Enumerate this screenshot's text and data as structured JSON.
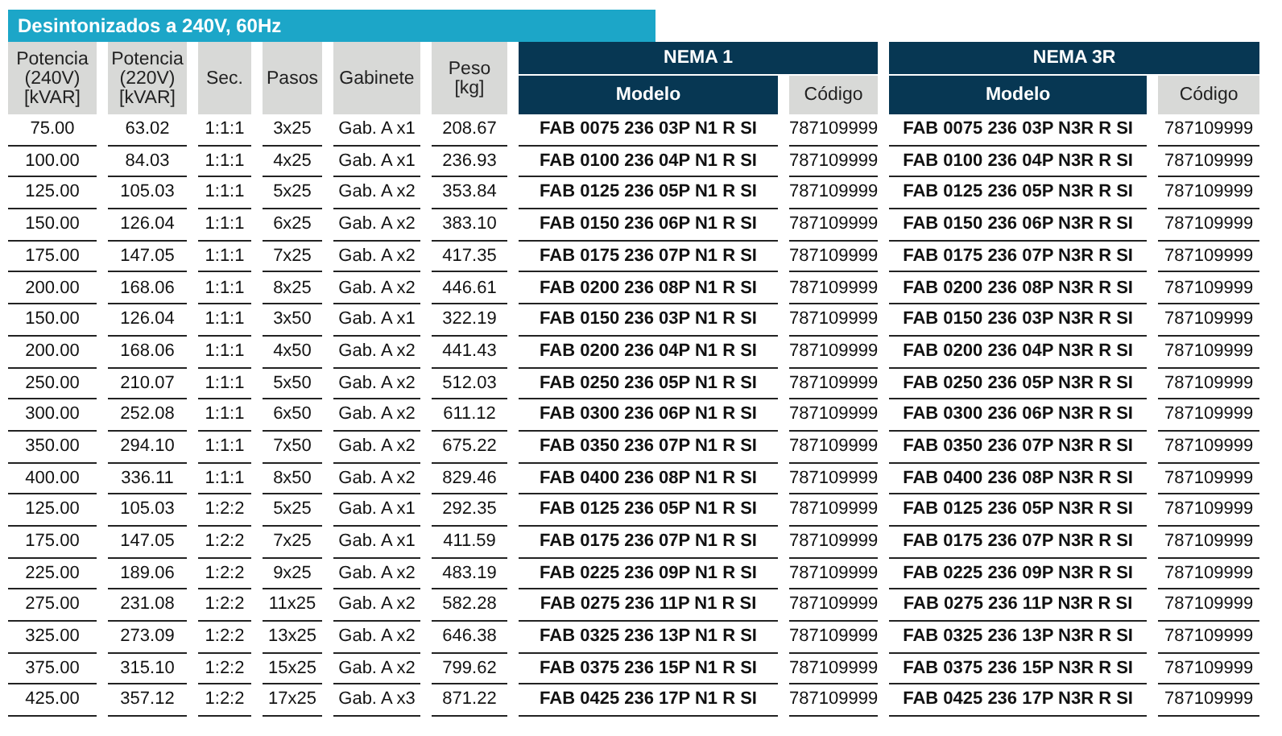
{
  "title": "Desintonizados a 240V, 60Hz",
  "table": {
    "columns": [
      {
        "lines": [
          "Potencia",
          "(240V)",
          "[kVAR]"
        ]
      },
      {
        "lines": [
          "Potencia",
          "(220V)",
          "[kVAR]"
        ]
      },
      {
        "lines": [
          "Sec."
        ]
      },
      {
        "lines": [
          "Pasos"
        ]
      },
      {
        "lines": [
          "Gabinete"
        ]
      },
      {
        "lines": [
          "Peso",
          "[kg]"
        ]
      }
    ],
    "groups": [
      {
        "label": "NEMA 1",
        "columns": [
          "Modelo",
          "Código"
        ]
      },
      {
        "label": "NEMA 3R",
        "columns": [
          "Modelo",
          "Código"
        ]
      }
    ],
    "rows": [
      [
        "75.00",
        "63.02",
        "1:1:1",
        "3x25",
        "Gab. A x1",
        "208.67",
        "FAB 0075 236 03P N1 R SI",
        "787109999",
        "FAB 0075 236 03P N3R R SI",
        "787109999"
      ],
      [
        "100.00",
        "84.03",
        "1:1:1",
        "4x25",
        "Gab. A x1",
        "236.93",
        "FAB 0100 236 04P N1 R SI",
        "787109999",
        "FAB 0100 236 04P N3R R SI",
        "787109999"
      ],
      [
        "125.00",
        "105.03",
        "1:1:1",
        "5x25",
        "Gab. A x2",
        "353.84",
        "FAB 0125 236 05P N1 R SI",
        "787109999",
        "FAB 0125 236 05P N3R R SI",
        "787109999"
      ],
      [
        "150.00",
        "126.04",
        "1:1:1",
        "6x25",
        "Gab. A x2",
        "383.10",
        "FAB 0150 236 06P N1 R SI",
        "787109999",
        "FAB 0150 236 06P N3R R SI",
        "787109999"
      ],
      [
        "175.00",
        "147.05",
        "1:1:1",
        "7x25",
        "Gab. A x2",
        "417.35",
        "FAB 0175 236 07P N1 R SI",
        "787109999",
        "FAB 0175 236 07P N3R R SI",
        "787109999"
      ],
      [
        "200.00",
        "168.06",
        "1:1:1",
        "8x25",
        "Gab. A x2",
        "446.61",
        "FAB 0200 236 08P N1 R SI",
        "787109999",
        "FAB 0200 236 08P N3R R SI",
        "787109999"
      ],
      [
        "150.00",
        "126.04",
        "1:1:1",
        "3x50",
        "Gab. A x1",
        "322.19",
        "FAB 0150 236 03P N1 R SI",
        "787109999",
        "FAB 0150 236 03P N3R R SI",
        "787109999"
      ],
      [
        "200.00",
        "168.06",
        "1:1:1",
        "4x50",
        "Gab. A x2",
        "441.43",
        "FAB 0200 236 04P N1 R SI",
        "787109999",
        "FAB 0200 236 04P N3R R SI",
        "787109999"
      ],
      [
        "250.00",
        "210.07",
        "1:1:1",
        "5x50",
        "Gab. A x2",
        "512.03",
        "FAB 0250 236 05P N1 R SI",
        "787109999",
        "FAB 0250 236 05P N3R R SI",
        "787109999"
      ],
      [
        "300.00",
        "252.08",
        "1:1:1",
        "6x50",
        "Gab. A x2",
        "611.12",
        "FAB 0300 236 06P N1 R SI",
        "787109999",
        "FAB 0300 236 06P N3R R SI",
        "787109999"
      ],
      [
        "350.00",
        "294.10",
        "1:1:1",
        "7x50",
        "Gab. A x2",
        "675.22",
        "FAB 0350 236 07P N1 R SI",
        "787109999",
        "FAB 0350 236 07P N3R R SI",
        "787109999"
      ],
      [
        "400.00",
        "336.11",
        "1:1:1",
        "8x50",
        "Gab. A x2",
        "829.46",
        "FAB 0400 236 08P N1 R SI",
        "787109999",
        "FAB 0400 236 08P N3R R SI",
        "787109999"
      ],
      [
        "125.00",
        "105.03",
        "1:2:2",
        "5x25",
        "Gab. A x1",
        "292.35",
        "FAB 0125 236 05P N1 R SI",
        "787109999",
        "FAB 0125 236 05P N3R R SI",
        "787109999"
      ],
      [
        "175.00",
        "147.05",
        "1:2:2",
        "7x25",
        "Gab. A x1",
        "411.59",
        "FAB 0175 236 07P N1 R SI",
        "787109999",
        "FAB 0175 236 07P N3R R SI",
        "787109999"
      ],
      [
        "225.00",
        "189.06",
        "1:2:2",
        "9x25",
        "Gab. A x2",
        "483.19",
        "FAB 0225 236 09P N1 R SI",
        "787109999",
        "FAB 0225 236 09P N3R R SI",
        "787109999"
      ],
      [
        "275.00",
        "231.08",
        "1:2:2",
        "11x25",
        "Gab. A x2",
        "582.28",
        "FAB 0275 236 11P N1 R SI",
        "787109999",
        "FAB 0275 236 11P N3R R SI",
        "787109999"
      ],
      [
        "325.00",
        "273.09",
        "1:2:2",
        "13x25",
        "Gab. A x2",
        "646.38",
        "FAB 0325 236 13P N1 R SI",
        "787109999",
        "FAB 0325 236 13P N3R R SI",
        "787109999"
      ],
      [
        "375.00",
        "315.10",
        "1:2:2",
        "15x25",
        "Gab. A x2",
        "799.62",
        "FAB 0375 236 15P N1 R SI",
        "787109999",
        "FAB 0375 236 15P N3R R SI",
        "787109999"
      ],
      [
        "425.00",
        "357.12",
        "1:2:2",
        "17x25",
        "Gab. A x3",
        "871.22",
        "FAB 0425 236 17P N1 R SI",
        "787109999",
        "FAB 0425 236 17P N3R R SI",
        "787109999"
      ]
    ]
  }
}
